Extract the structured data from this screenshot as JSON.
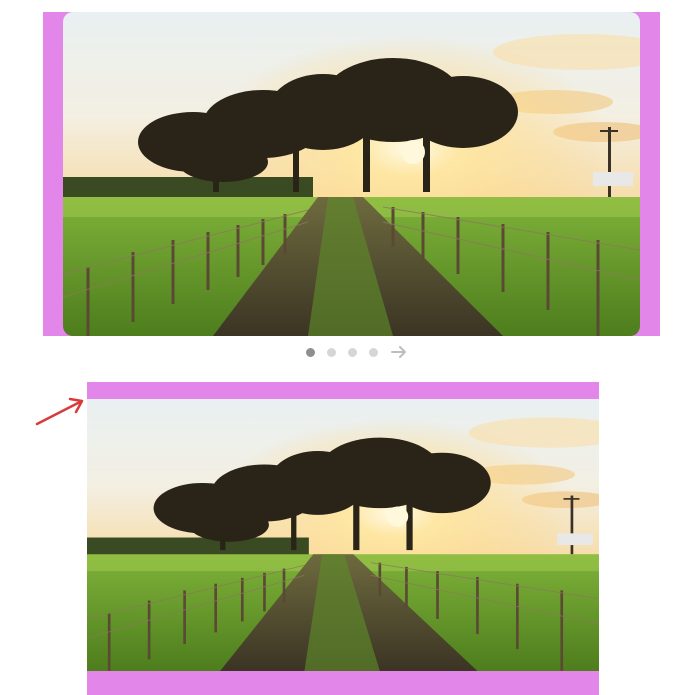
{
  "carousel_top": {
    "slide_image": "landscape-photo-sunset-dirt-road-fence"
  },
  "pagination": {
    "total_dots": 4,
    "active_index": 0,
    "next_icon": "arrow-right-icon"
  },
  "carousel_bottom": {
    "slide_image": "landscape-photo-sunset-dirt-road-fence"
  },
  "annotation": {
    "arrow_icon": "red-arrow-icon",
    "arrow_color": "#d83b3b"
  },
  "colors": {
    "highlight": "#e386ea",
    "dot_active": "#8f8f8f",
    "dot_inactive": "#d6d6d6"
  }
}
